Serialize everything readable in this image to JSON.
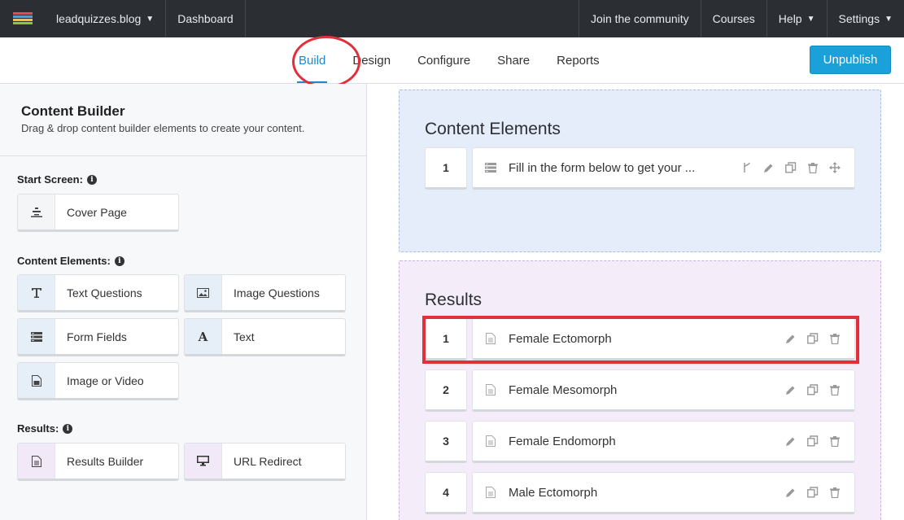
{
  "topbar": {
    "site": "leadquizzes.blog",
    "dashboard": "Dashboard",
    "community": "Join the community",
    "courses": "Courses",
    "help": "Help",
    "settings": "Settings"
  },
  "tabs": [
    "Build",
    "Design",
    "Configure",
    "Share",
    "Reports"
  ],
  "active_tab": "Build",
  "unpublish": "Unpublish",
  "builder": {
    "title": "Content Builder",
    "subtitle": "Drag & drop content builder elements to create your content.",
    "start_label": "Start Screen:",
    "start_items": [
      "Cover Page"
    ],
    "content_label": "Content Elements:",
    "content_items": [
      "Text Questions",
      "Image Questions",
      "Form Fields",
      "Text",
      "Image or Video"
    ],
    "results_label": "Results:",
    "results_items": [
      "Results Builder",
      "URL Redirect"
    ]
  },
  "content_panel": {
    "title": "Content Elements",
    "rows": [
      {
        "num": "1",
        "text": "Fill in the form below to get your ..."
      }
    ]
  },
  "results_panel": {
    "title": "Results",
    "rows": [
      {
        "num": "1",
        "text": "Female Ectomorph"
      },
      {
        "num": "2",
        "text": "Female Mesomorph"
      },
      {
        "num": "3",
        "text": "Female Endomorph"
      },
      {
        "num": "4",
        "text": "Male Ectomorph"
      }
    ]
  },
  "colors": {
    "accent": "#1c8ad1",
    "button": "#1ba1d9",
    "highlight": "#e0303a",
    "topbar": "#2b2f33"
  }
}
